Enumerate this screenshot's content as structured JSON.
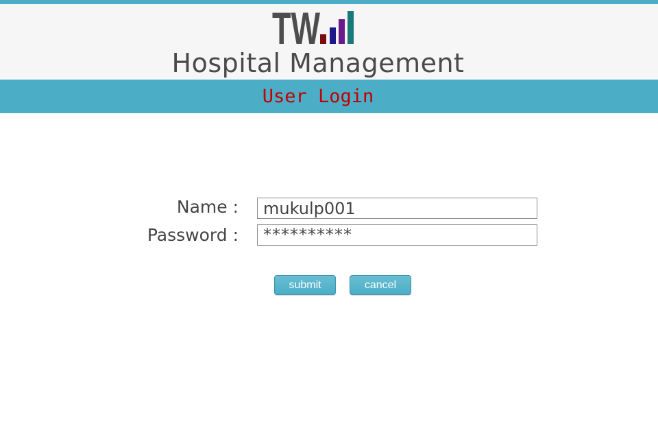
{
  "colors": {
    "accent": "#4caec6",
    "login_title": "#c00000"
  },
  "header": {
    "logo_text": "TW",
    "logo_icon": "bar-chart-icon",
    "app_title": "Hospital Management"
  },
  "login_bar": {
    "title": "User Login"
  },
  "form": {
    "name_label": "Name :",
    "name_value": "mukulp001",
    "password_label": "Password :",
    "password_value": "**********"
  },
  "buttons": {
    "submit_label": "submit",
    "cancel_label": "cancel"
  }
}
